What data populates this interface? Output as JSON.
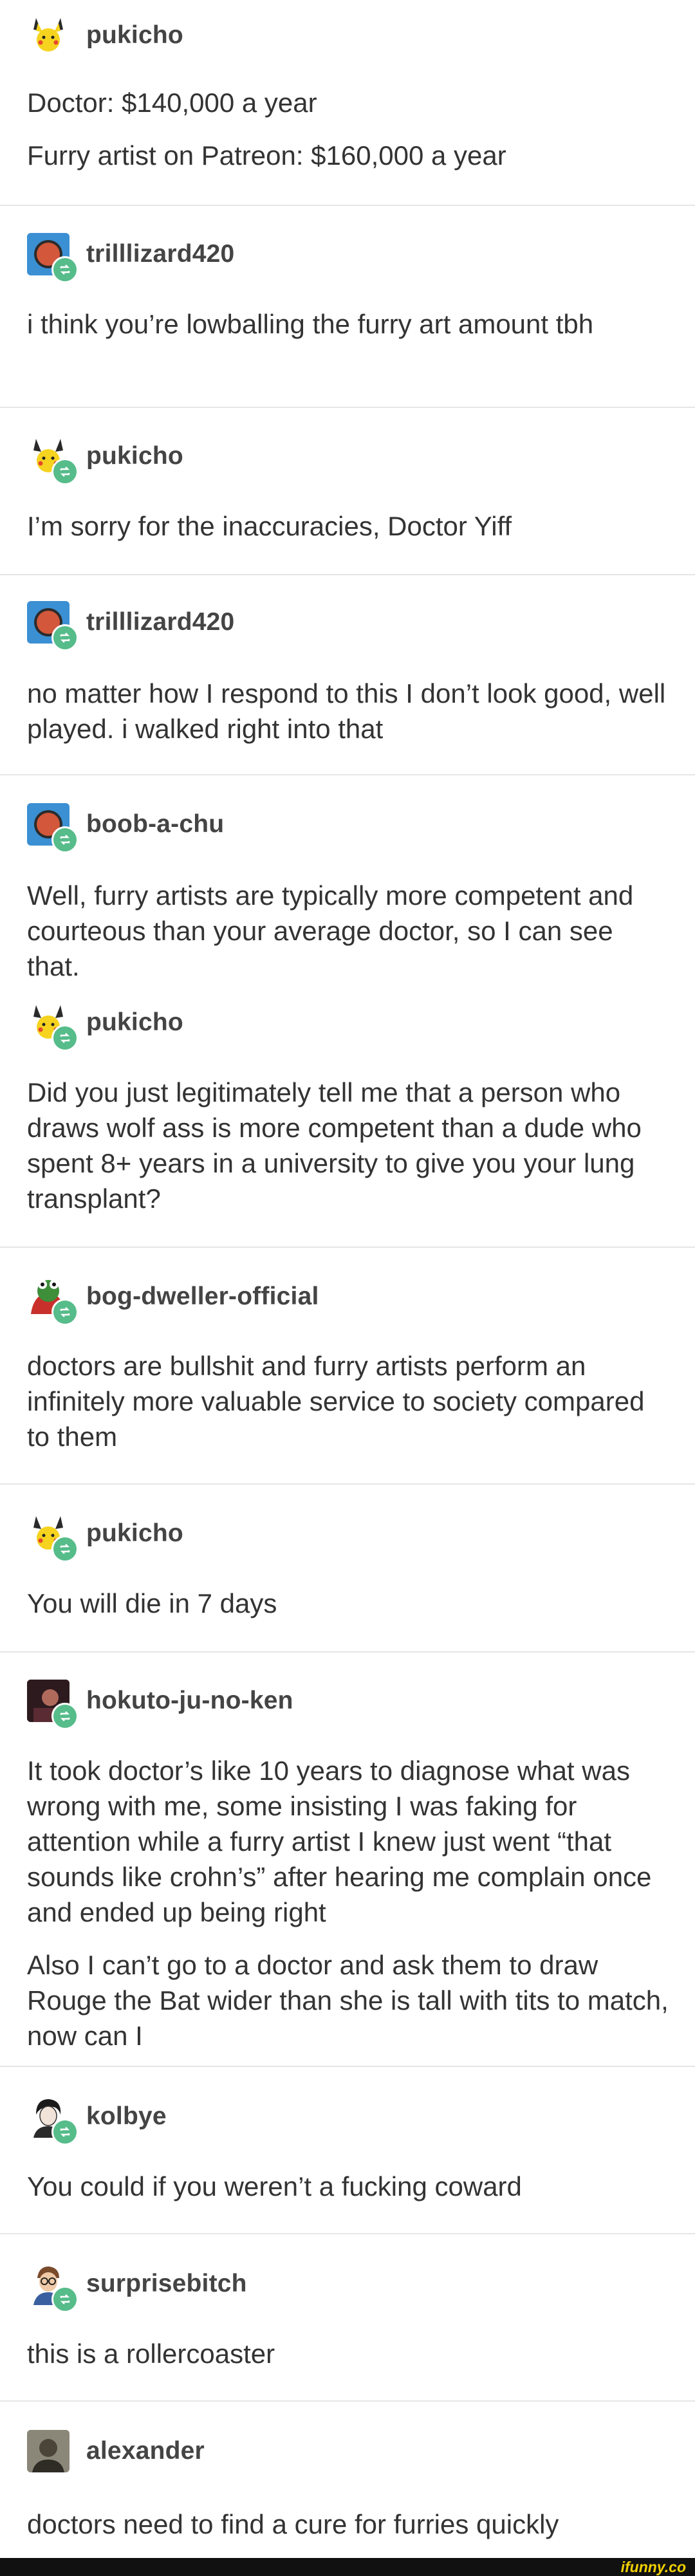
{
  "posts": [
    {
      "user": "pukicho",
      "avatar": "pikachu",
      "reblog": false,
      "lines": [
        "Doctor: $140,000 a year",
        "Furry artist on Patreon: $160,000 a year"
      ]
    },
    {
      "user": "trilllizard420",
      "avatar": "red-circle",
      "reblog": true,
      "lines": [
        "i think you’re lowballing the furry art amount tbh"
      ]
    },
    {
      "user": "pukicho",
      "avatar": "pikachu",
      "reblog": true,
      "lines": [
        "I’m sorry for the inaccuracies, Doctor Yiff"
      ]
    },
    {
      "user": "trilllizard420",
      "avatar": "red-circle",
      "reblog": true,
      "lines": [
        "no matter how I respond to this I don’t look good, well played. i walked right into that"
      ]
    },
    {
      "user": "boob-a-chu",
      "avatar": "red-circle",
      "reblog": true,
      "lines": [
        "Well, furry artists are typically more competent and courteous than your average doctor, so I can see that."
      ]
    },
    {
      "user": "pukicho",
      "avatar": "pikachu",
      "reblog": true,
      "lines": [
        "Did you just legitimately tell me that a person who draws wolf ass is more competent than a dude who spent 8+ years in a university to give you your lung transplant?"
      ]
    },
    {
      "user": "bog-dweller-official",
      "avatar": "frog",
      "reblog": true,
      "lines": [
        "doctors are bullshit and furry artists perform an infinitely more valuable service to society compared to them"
      ]
    },
    {
      "user": "pukicho",
      "avatar": "pikachu",
      "reblog": true,
      "lines": [
        "You will die in 7 days"
      ]
    },
    {
      "user": "hokuto-ju-no-ken",
      "avatar": "dark-photo",
      "reblog": true,
      "lines": [
        "It took doctor’s like 10 years to diagnose what was wrong with me, some insisting I was faking for attention while a furry artist I knew just went “that sounds like crohn’s” after hearing me complain once and ended up being right",
        "Also I can’t go to a doctor and ask them to draw Rouge the Bat wider than she is tall with tits to match, now can I"
      ]
    },
    {
      "user": "kolbye",
      "avatar": "sketch-person",
      "reblog": true,
      "lines": [
        "You could if you weren’t a fucking coward"
      ]
    },
    {
      "user": "surprisebitch",
      "avatar": "glasses-person",
      "reblog": true,
      "lines": [
        "this is a rollercoaster"
      ]
    },
    {
      "user": "alexander",
      "avatar": "grey-photo",
      "reblog": false,
      "lines": [
        "doctors need to find a cure for furries quickly"
      ]
    }
  ],
  "watermark": "ifunny.co"
}
